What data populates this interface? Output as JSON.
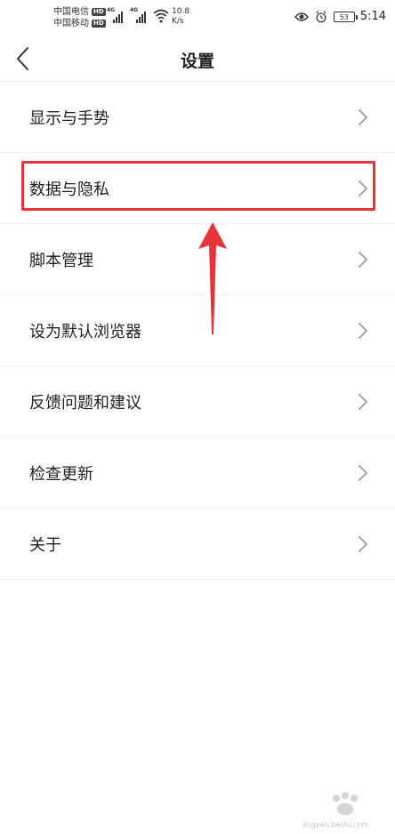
{
  "status_bar": {
    "carrier1": "中国电信",
    "carrier2": "中国移动",
    "hd_badge": "HD",
    "network_tag": "4G",
    "speed_value": "10.8",
    "speed_unit": "K/s",
    "battery": "53",
    "time": "5:14",
    "icons": [
      "signal-icon",
      "wifi-icon",
      "eye-icon",
      "alarm-icon",
      "battery-icon"
    ]
  },
  "header": {
    "title": "设置",
    "back_icon": "back-chevron-icon"
  },
  "settings": {
    "items": [
      {
        "label": "显示与手势"
      },
      {
        "label": "数据与隐私"
      },
      {
        "label": "脚本管理"
      },
      {
        "label": "设为默认浏览器"
      },
      {
        "label": "反馈问题和建议"
      },
      {
        "label": "检查更新"
      },
      {
        "label": "关于"
      }
    ],
    "highlighted_index": 1
  },
  "colors": {
    "annotation": "#e8323c",
    "divider": "#efefef",
    "text": "#222222",
    "chevron": "#9a9a9a"
  },
  "watermark": {
    "text": "jingyan.baidu.com"
  }
}
